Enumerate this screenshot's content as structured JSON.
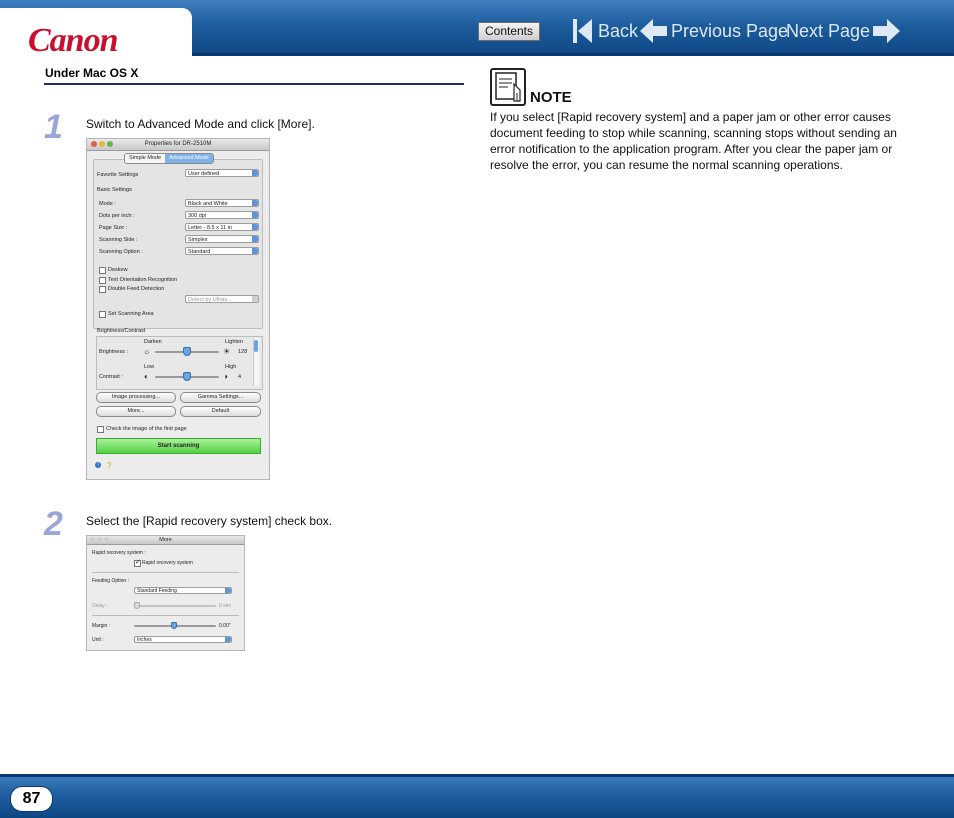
{
  "header": {
    "logo_text": "Canon",
    "contents_label": "Contents",
    "back_label": "Back",
    "previous_label": "Previous Page",
    "next_label": "Next Page"
  },
  "section": {
    "heading": "Under Mac OS X"
  },
  "steps": [
    {
      "number": "1",
      "text": "Switch to Advanced Mode and click [More]."
    },
    {
      "number": "2",
      "text": "Select the [Rapid recovery system] check box."
    }
  ],
  "screenshot1": {
    "title": "Properties for DR-2510M",
    "tabs": [
      "Simple Mode",
      "Advanced Mode"
    ],
    "favorite_settings_label": "Favorite Settings",
    "favorite_settings_value": "User defined",
    "basic_settings_label": "Basic Settings",
    "rows": [
      {
        "label": "Mode :",
        "value": "Black and White"
      },
      {
        "label": "Dots per inch :",
        "value": "300 dpi"
      },
      {
        "label": "Page Size :",
        "value": "Letter - 8.5 x 11 in"
      },
      {
        "label": "Scanning Side :",
        "value": "Simplex"
      },
      {
        "label": "Scanning Option :",
        "value": "Standard"
      }
    ],
    "checkboxes": [
      "Deskew",
      "Text Orientation Recognition",
      "Double Feed Detection"
    ],
    "detect_value": "Detect by Ultras...",
    "set_scanning_area": "Set Scanning Area",
    "brightness_contrast_label": "Brightness/Contrast",
    "darken_label": "Darken",
    "lighten_label": "Lighten",
    "brightness_label": "Brightness :",
    "brightness_value": "128",
    "low_label": "Low",
    "high_label": "High",
    "contrast_label": "Contrast :",
    "contrast_value": "4",
    "buttons": [
      "Image processing...",
      "Gamma Settings...",
      "More...",
      "Default"
    ],
    "check_first_page": "Check the image of the first page",
    "start_scanning": "Start scanning"
  },
  "screenshot2": {
    "title": "More",
    "rapid_label": "Rapid recovery system :",
    "rapid_checkbox": "Rapid recovery system",
    "feeding_label": "Feeding Option :",
    "feeding_value": "Standard Feeding",
    "delay_label": "Delay :",
    "delay_value": "0 sec",
    "margin_label": "Margin :",
    "margin_value": "0.00\"",
    "unit_label": "Unit :",
    "unit_value": "Inches"
  },
  "note": {
    "label": "NOTE",
    "body": "If you select [Rapid recovery system] and a paper jam or other error causes document feeding to stop while scanning, scanning stops without sending an error notification to the application program. After you clear the paper jam or resolve the error, you can resume the normal scanning operations."
  },
  "footer": {
    "page_number": "87"
  },
  "colors": {
    "brand_red": "#c8102e",
    "header_blue": "#1d5c9d",
    "step_number": "#9aa6d8",
    "rule": "#1b2f6e"
  }
}
